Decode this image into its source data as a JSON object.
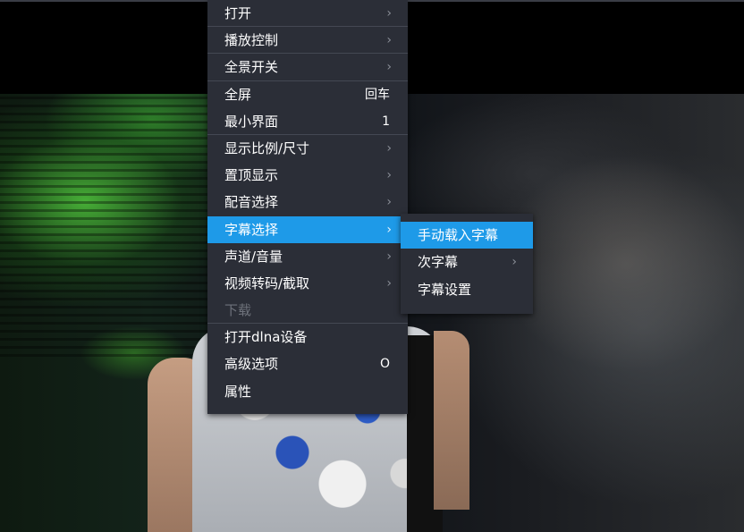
{
  "menu": {
    "items": [
      {
        "label": "打开",
        "shortcut": "",
        "submenu": true,
        "separator_after": true,
        "active": false,
        "disabled": false
      },
      {
        "label": "播放控制",
        "shortcut": "",
        "submenu": true,
        "separator_after": true,
        "active": false,
        "disabled": false
      },
      {
        "label": "全景开关",
        "shortcut": "",
        "submenu": true,
        "separator_after": true,
        "active": false,
        "disabled": false
      },
      {
        "label": "全屏",
        "shortcut": "回车",
        "submenu": false,
        "separator_after": false,
        "active": false,
        "disabled": false
      },
      {
        "label": "最小界面",
        "shortcut": "1",
        "submenu": false,
        "separator_after": true,
        "active": false,
        "disabled": false
      },
      {
        "label": "显示比例/尺寸",
        "shortcut": "",
        "submenu": true,
        "separator_after": false,
        "active": false,
        "disabled": false
      },
      {
        "label": "置顶显示",
        "shortcut": "",
        "submenu": true,
        "separator_after": false,
        "active": false,
        "disabled": false
      },
      {
        "label": "配音选择",
        "shortcut": "",
        "submenu": true,
        "separator_after": false,
        "active": false,
        "disabled": false
      },
      {
        "label": "字幕选择",
        "shortcut": "",
        "submenu": true,
        "separator_after": false,
        "active": true,
        "disabled": false
      },
      {
        "label": "声道/音量",
        "shortcut": "",
        "submenu": true,
        "separator_after": false,
        "active": false,
        "disabled": false
      },
      {
        "label": "视频转码/截取",
        "shortcut": "",
        "submenu": true,
        "separator_after": false,
        "active": false,
        "disabled": false
      },
      {
        "label": "下载",
        "shortcut": "",
        "submenu": false,
        "separator_after": true,
        "active": false,
        "disabled": true
      },
      {
        "label": "打开dlna设备",
        "shortcut": "",
        "submenu": false,
        "separator_after": false,
        "active": false,
        "disabled": false
      },
      {
        "label": "高级选项",
        "shortcut": "O",
        "submenu": false,
        "separator_after": false,
        "active": false,
        "disabled": false
      },
      {
        "label": "属性",
        "shortcut": "",
        "submenu": false,
        "separator_after": false,
        "active": false,
        "disabled": false
      }
    ],
    "chevron_glyph": "›"
  },
  "subtitle_submenu": {
    "items": [
      {
        "label": "手动载入字幕",
        "submenu": false,
        "active": true
      },
      {
        "label": "次字幕",
        "submenu": true,
        "active": false
      },
      {
        "label": "字幕设置",
        "submenu": false,
        "active": false
      }
    ]
  },
  "colors": {
    "menu_bg": "#2b2e37",
    "highlight": "#1e9ae8",
    "separator": "#444853",
    "disabled_text": "#6e727b"
  }
}
